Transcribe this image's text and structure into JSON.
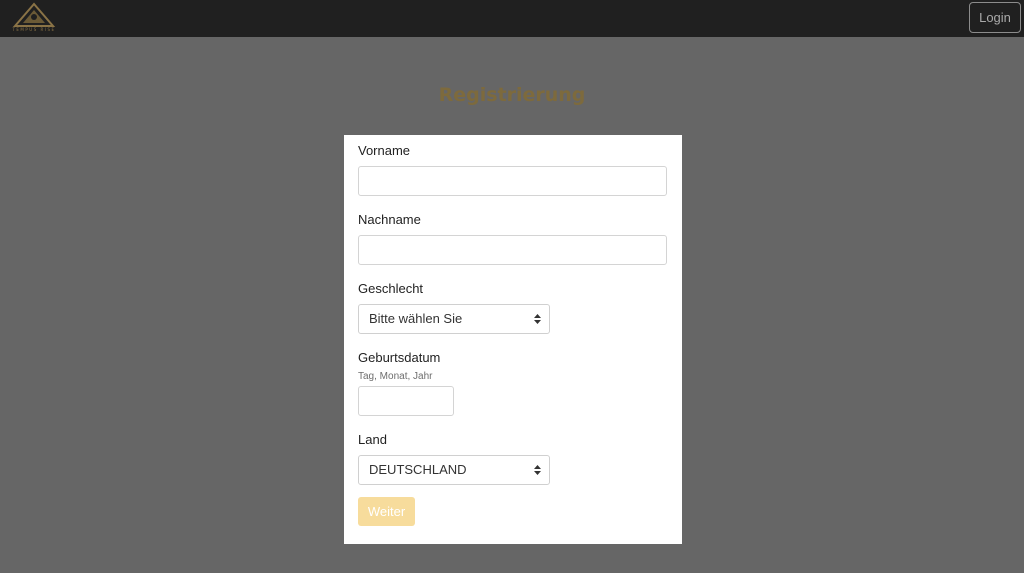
{
  "header": {
    "logo_icon": "mountain-logo-icon",
    "logo_text": "TEMPUS RISE",
    "login_label": "Login"
  },
  "page": {
    "title": "Registrierung"
  },
  "form": {
    "first_name": {
      "label": "Vorname",
      "value": ""
    },
    "last_name": {
      "label": "Nachname",
      "value": ""
    },
    "gender": {
      "label": "Geschlecht",
      "selected": "Bitte wählen Sie"
    },
    "birthdate": {
      "label": "Geburtsdatum",
      "hint": "Tag, Monat, Jahr",
      "value": ""
    },
    "country": {
      "label": "Land",
      "selected": "DEUTSCHLAND"
    },
    "submit_label": "Weiter"
  },
  "colors": {
    "topbar": "#202020",
    "overlay": "#666666",
    "title": "#7d6a3d",
    "submit_button": "#f7dc9c"
  }
}
